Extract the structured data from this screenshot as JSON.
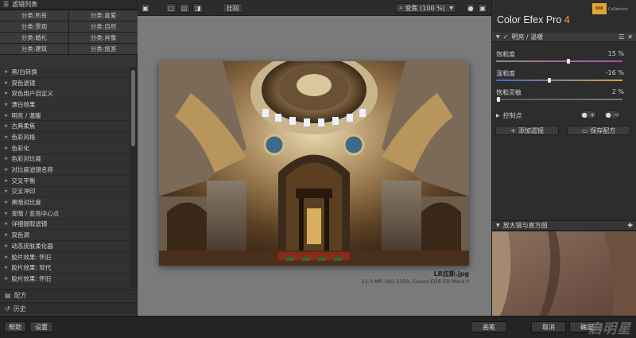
{
  "left_panel": {
    "header": "滤镜列表",
    "categories": [
      "分类:所有",
      "分类:喜爱",
      "分类:景观",
      "分类:自然",
      "分类:婚礼",
      "分类:肖像",
      "分类:建筑",
      "分类:旅游"
    ],
    "filters": [
      "黑/白转换",
      "双色滤镜",
      "双色用户自定义",
      "漂白效果",
      "明亮 / 温暖",
      "古典柔焦",
      "色彩风格",
      "色彩化",
      "色彩对比度",
      "对比度滤镜名称",
      "交叉平衡",
      "交叉冲印",
      "黑暗对比度",
      "变暗 / 变亮中心点",
      "详细提取滤镜",
      "双色调",
      "动态皮肤柔化器",
      "胶片效果: 怀旧",
      "胶片效果: 现代",
      "胶片效果: 怀旧"
    ],
    "recipes_label": "配方",
    "history_label": "历史"
  },
  "toolbar": {
    "compare_label": "比较",
    "zoom_label": "变焦 (100 %)"
  },
  "image": {
    "filename": "LR拉斯.jpg",
    "meta": "21.0 MP, ISO 1250, Canon EOS 5D Mark II"
  },
  "right_panel": {
    "brand": "Color Efex Pro",
    "version": "4",
    "nik_label": "NIK",
    "collection_label": "Collection",
    "filter_name": "明亮 / 温暖",
    "sliders": [
      {
        "label": "饱和度",
        "value": "15 %",
        "fraction": 0.57
      },
      {
        "label": "温和度",
        "value": "-16 %",
        "fraction": 0.42
      },
      {
        "label": "饱和灵敏",
        "value": "2 %",
        "fraction": 0.02
      }
    ],
    "control_points_label": "控制点",
    "add_filter_label": "添加滤镜",
    "save_recipe_label": "保存配方",
    "loupe_label": "放大镜与直方图"
  },
  "bottom_bar": {
    "help_label": "帮助",
    "settings_label": "设置",
    "brush_label": "画笔",
    "cancel_label": "取消",
    "ok_label": "确定",
    "watermark": "启明星"
  },
  "colors": {
    "accent_orange": "#f0a53a",
    "panel_bg": "#2d2d2d",
    "canvas_bg": "#7a7a7a"
  }
}
